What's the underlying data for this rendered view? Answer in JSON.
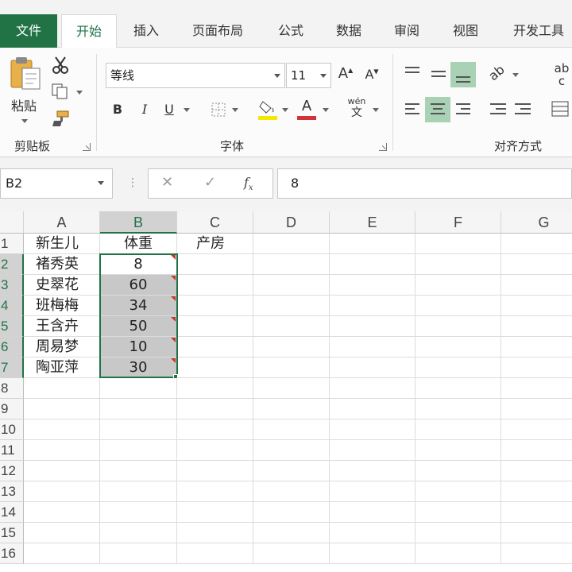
{
  "tabs": [
    "文件",
    "开始",
    "插入",
    "页面布局",
    "公式",
    "数据",
    "审阅",
    "视图",
    "开发工具"
  ],
  "ribbon": {
    "clipboard": {
      "paste_label": "粘贴",
      "group_label": "剪贴板"
    },
    "font": {
      "font_name": "等线",
      "font_size": "11",
      "bold": "B",
      "italic": "I",
      "underline": "U",
      "font_color_glyph": "A",
      "phonetic_top": "wén",
      "phonetic_bottom": "文",
      "group_label": "字体"
    },
    "alignment": {
      "group_label": "对齐方式",
      "wrap_top": "ab",
      "wrap_bottom": "c"
    },
    "accent_color": "#217346",
    "fill_color": "#f5e800",
    "font_color": "#d13438"
  },
  "formula_bar": {
    "name_box": "B2",
    "content": "8"
  },
  "grid": {
    "columns": [
      "A",
      "B",
      "C",
      "D",
      "E",
      "F",
      "G"
    ],
    "rows": [
      "1",
      "2",
      "3",
      "4",
      "5",
      "6",
      "7",
      "8",
      "9",
      "10",
      "11",
      "12",
      "13",
      "14",
      "15",
      "16"
    ],
    "data": [
      [
        "新生儿",
        "体重",
        "产房"
      ],
      [
        "褚秀英",
        "8"
      ],
      [
        "史翠花",
        "60"
      ],
      [
        "班梅梅",
        "34"
      ],
      [
        "王含卉",
        "50"
      ],
      [
        "周易梦",
        "10"
      ],
      [
        "陶亚萍",
        "30"
      ]
    ],
    "selected_column": "B",
    "active_cell": "B2"
  }
}
